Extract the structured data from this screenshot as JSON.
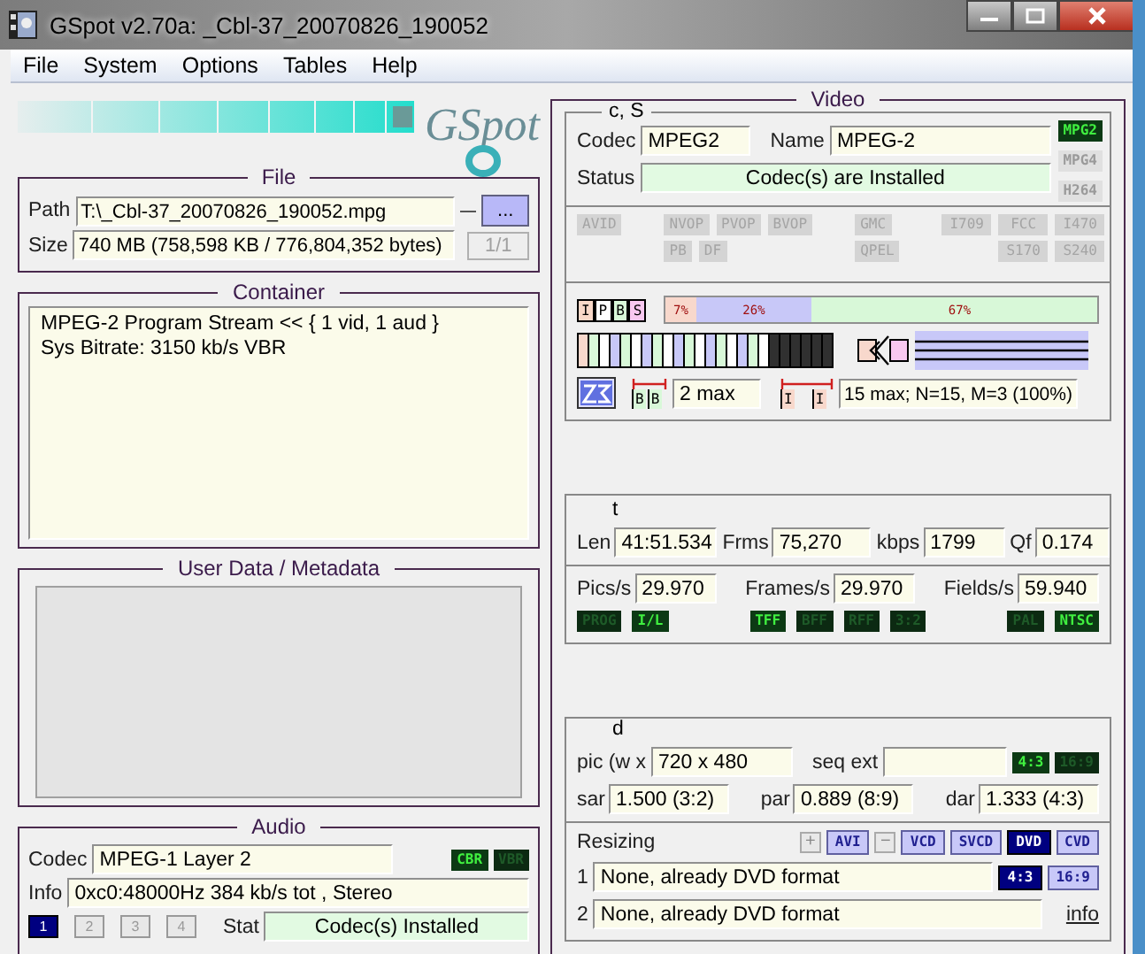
{
  "window": {
    "title": "GSpot v2.70a: _Cbl-37_20070826_190052"
  },
  "menu": [
    "File",
    "System",
    "Options",
    "Tables",
    "Help"
  ],
  "logo": {
    "text": "GSpot"
  },
  "file": {
    "title": "File",
    "path_label": "Path",
    "path": "T:\\_Cbl-37_20070826_190052.mpg",
    "browse_button": "...",
    "size_label": "Size",
    "size": "740 MB (758,598 KB / 776,804,352 bytes)",
    "part_button": {
      "label": "1/1",
      "disabled": true
    }
  },
  "container": {
    "title": "Container",
    "lines": [
      "MPEG-2 Program Stream << { 1 vid, 1 aud }",
      "Sys Bitrate: 3150 kb/s VBR"
    ]
  },
  "metadata": {
    "title": "User Data / Metadata"
  },
  "audio": {
    "title": "Audio",
    "codec_label": "Codec",
    "codec": "MPEG-1 Layer 2",
    "rate_flags": [
      {
        "label": "CBR",
        "on": true
      },
      {
        "label": "VBR",
        "on": false
      }
    ],
    "info_label": "Info",
    "info": "0xc0:48000Hz  384 kb/s tot , Stereo",
    "streams": [
      {
        "label": "1",
        "selected": true
      },
      {
        "label": "2",
        "selected": false
      },
      {
        "label": "3",
        "selected": false
      },
      {
        "label": "4",
        "selected": false
      }
    ],
    "stat_label": "Stat",
    "stat": "Codec(s) Installed"
  },
  "video": {
    "title": "Video",
    "cs": {
      "title": "c, S",
      "codec_label": "Codec",
      "codec": "MPEG2",
      "name_label": "Name",
      "name": "MPEG-2",
      "status_label": "Status",
      "status": "Codec(s) are Installed",
      "codec_flags": [
        {
          "label": "MPG2",
          "on": true
        },
        {
          "label": "MPG4",
          "on": false
        },
        {
          "label": "H264",
          "on": false
        }
      ]
    },
    "feature_groups": [
      {
        "rows": [
          [
            {
              "label": "AVID",
              "on": false
            }
          ]
        ]
      },
      {
        "rows": [
          [
            {
              "label": "NVOP",
              "on": false
            },
            {
              "label": "PVOP",
              "on": false
            },
            {
              "label": "BVOP",
              "on": false
            }
          ],
          [
            {
              "label": "PB",
              "on": false
            },
            {
              "label": "DF",
              "on": false
            }
          ]
        ]
      },
      {
        "rows": [
          [
            {
              "label": "GMC",
              "on": false
            }
          ],
          [
            {
              "label": "QPEL",
              "on": false
            }
          ]
        ]
      },
      {
        "rows": [
          [
            {
              "label": "I709",
              "on": false
            },
            {
              "label": "FCC",
              "on": false
            },
            {
              "label": "I470",
              "on": false
            }
          ],
          [
            null,
            {
              "label": "S170",
              "on": false
            },
            {
              "label": "S240",
              "on": false
            }
          ]
        ]
      }
    ],
    "frames": {
      "types": [
        {
          "label": "I",
          "color": "#f8d8c8"
        },
        {
          "label": "P",
          "color": "#ffffff"
        },
        {
          "label": "B",
          "color": "#d8f8d8"
        },
        {
          "label": "S",
          "color": "#f8c8f0"
        }
      ],
      "distribution": [
        {
          "label": "7%",
          "level": 0.07,
          "color": "#f8d8cc"
        },
        {
          "label": "26%",
          "level": 0.26,
          "color": "#c8c8f8"
        },
        {
          "label": "67%",
          "level": 0.67,
          "color": "#d8f8d8"
        }
      ],
      "b_marks": [
        "B",
        "B"
      ],
      "b_run": "2 max",
      "i_marks": [
        "I",
        "I"
      ],
      "gop": "15 max; N=15, M=3 (100%)"
    },
    "timing": {
      "title": "t",
      "fields": [
        {
          "label": "Len",
          "value": "41:51.534"
        },
        {
          "label": "Frms",
          "value": "75,270"
        },
        {
          "label": "kbps",
          "value": "1799"
        },
        {
          "label": "Qf",
          "value": "0.174"
        }
      ],
      "rates": [
        {
          "label": "Pics/s",
          "value": "29.970"
        },
        {
          "label": "Frames/s",
          "value": "29.970"
        },
        {
          "label": "Fields/s",
          "value": "59.940"
        }
      ],
      "flag_groups": [
        [
          {
            "label": "PROG",
            "on": false
          },
          {
            "label": "I/L",
            "on": true
          }
        ],
        [
          {
            "label": "TFF",
            "on": true
          },
          {
            "label": "BFF",
            "on": false
          },
          {
            "label": "RFF",
            "on": false
          },
          {
            "label": "3:2",
            "on": false
          }
        ],
        [
          {
            "label": "PAL",
            "on": false
          },
          {
            "label": "NTSC",
            "on": true
          }
        ]
      ]
    },
    "dimensions": {
      "title": "d",
      "pic_label": "pic (w x",
      "pic": "720 x 480",
      "seq_ext_label": "seq ext",
      "aspect_flags": [
        {
          "label": "4:3",
          "on": true
        },
        {
          "label": "16:9",
          "on": false
        }
      ],
      "ratios": [
        {
          "label": "sar",
          "value": "1.500 (3:2)"
        },
        {
          "label": "par",
          "value": "0.889 (8:9)"
        },
        {
          "label": "dar",
          "value": "1.333 (4:3)"
        }
      ],
      "resizing_label": "Resizing",
      "resize_buttons": [
        {
          "label": "+",
          "kind": "small",
          "selected": false
        },
        {
          "label": "AVI",
          "kind": "format",
          "selected": false
        },
        {
          "label": "−",
          "kind": "small",
          "selected": false
        },
        {
          "label": "VCD",
          "kind": "format",
          "selected": false
        },
        {
          "label": "SVCD",
          "kind": "format",
          "selected": false
        },
        {
          "label": "DVD",
          "kind": "format",
          "selected": true
        },
        {
          "label": "CVD",
          "kind": "format",
          "selected": false
        }
      ],
      "rows": [
        {
          "number": "1",
          "value": "None, already DVD format"
        },
        {
          "number": "2",
          "value": "None, already DVD format"
        }
      ],
      "row_aspects": [
        {
          "label": "4:3",
          "selected": true
        },
        {
          "label": "16:9",
          "selected": false
        }
      ],
      "info_link": "info"
    }
  }
}
